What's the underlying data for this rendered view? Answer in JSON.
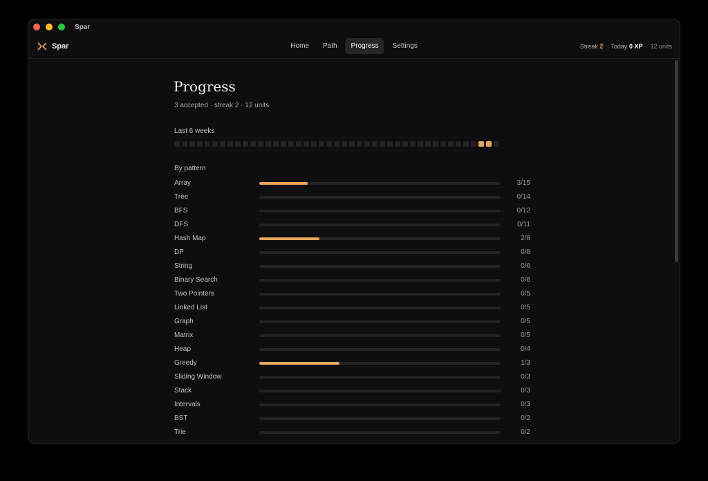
{
  "window": {
    "title": "Spar"
  },
  "brand": {
    "name": "Spar",
    "accent": "#e9a55b"
  },
  "nav": [
    {
      "label": "Home",
      "active": false
    },
    {
      "label": "Path",
      "active": false
    },
    {
      "label": "Progress",
      "active": true
    },
    {
      "label": "Settings",
      "active": false
    }
  ],
  "stats": {
    "streak_label": "Streak",
    "streak_value": "2",
    "today_label": "Today",
    "today_value": "0 XP",
    "units": "12 units"
  },
  "page": {
    "title": "Progress",
    "summary": "3 accepted · streak 2 · 12 units",
    "heatmap_label": "Last 6 weeks",
    "heatmap": [
      0,
      0,
      0,
      0,
      0,
      0,
      0,
      0,
      0,
      0,
      0,
      0,
      0,
      0,
      0,
      0,
      0,
      0,
      0,
      0,
      0,
      0,
      0,
      0,
      0,
      0,
      0,
      0,
      0,
      0,
      0,
      0,
      0,
      0,
      0,
      0,
      0,
      0,
      0,
      0,
      1,
      1,
      0
    ],
    "pattern_label": "By pattern",
    "patterns": [
      {
        "name": "Array",
        "count": "3/15",
        "done": 3,
        "total": 15
      },
      {
        "name": "Tree",
        "count": "0/14",
        "done": 0,
        "total": 14
      },
      {
        "name": "BFS",
        "count": "0/12",
        "done": 0,
        "total": 12
      },
      {
        "name": "DFS",
        "count": "0/11",
        "done": 0,
        "total": 11
      },
      {
        "name": "Hash Map",
        "count": "2/8",
        "done": 2,
        "total": 8
      },
      {
        "name": "DP",
        "count": "0/8",
        "done": 0,
        "total": 8
      },
      {
        "name": "String",
        "count": "0/6",
        "done": 0,
        "total": 6
      },
      {
        "name": "Binary Search",
        "count": "0/6",
        "done": 0,
        "total": 6
      },
      {
        "name": "Two Pointers",
        "count": "0/5",
        "done": 0,
        "total": 5
      },
      {
        "name": "Linked List",
        "count": "0/5",
        "done": 0,
        "total": 5
      },
      {
        "name": "Graph",
        "count": "0/5",
        "done": 0,
        "total": 5
      },
      {
        "name": "Matrix",
        "count": "0/5",
        "done": 0,
        "total": 5
      },
      {
        "name": "Heap",
        "count": "0/4",
        "done": 0,
        "total": 4
      },
      {
        "name": "Greedy",
        "count": "1/3",
        "done": 1,
        "total": 3
      },
      {
        "name": "Sliding Window",
        "count": "0/3",
        "done": 0,
        "total": 3
      },
      {
        "name": "Stack",
        "count": "0/3",
        "done": 0,
        "total": 3
      },
      {
        "name": "Intervals",
        "count": "0/3",
        "done": 0,
        "total": 3
      },
      {
        "name": "BST",
        "count": "0/2",
        "done": 0,
        "total": 2
      },
      {
        "name": "Trie",
        "count": "0/2",
        "done": 0,
        "total": 2
      }
    ]
  }
}
